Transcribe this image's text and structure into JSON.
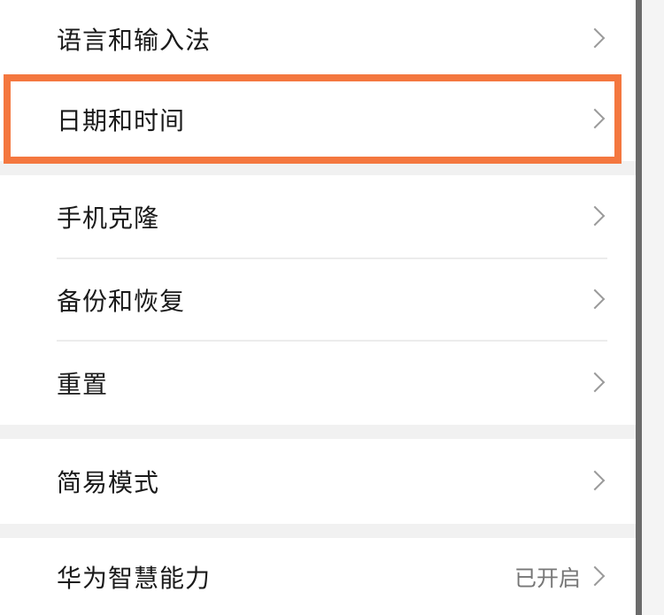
{
  "settings": {
    "items": [
      {
        "label": "语言和输入法"
      },
      {
        "label": "日期和时间"
      },
      {
        "label": "手机克隆"
      },
      {
        "label": "备份和恢复"
      },
      {
        "label": "重置"
      },
      {
        "label": "简易模式"
      },
      {
        "label": "华为智慧能力",
        "value": "已开启"
      }
    ]
  },
  "highlight": {
    "color": "#f4773f",
    "target": "日期和时间"
  }
}
